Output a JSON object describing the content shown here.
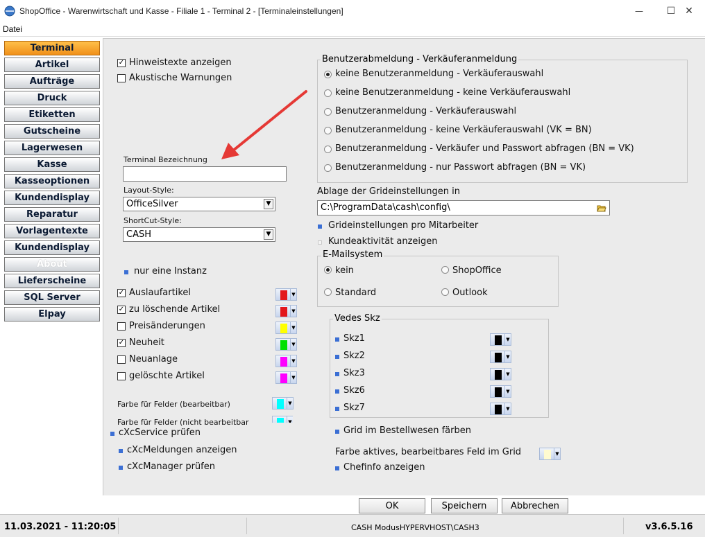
{
  "window": {
    "title": "ShopOffice - Warenwirtschaft und Kasse - Filiale 1 - Terminal 2 - [Terminaleinstellungen]",
    "minimize": "—",
    "maximize": "☐",
    "close": "✕"
  },
  "menu": {
    "datei": "Datei"
  },
  "sidebar": {
    "active": "Terminal",
    "items": [
      {
        "label": "Terminal",
        "state": "active"
      },
      {
        "label": "Artikel",
        "state": "normal"
      },
      {
        "label": "Aufträge",
        "state": "normal"
      },
      {
        "label": "Druck",
        "state": "normal"
      },
      {
        "label": "Etiketten",
        "state": "normal"
      },
      {
        "label": "Gutscheine",
        "state": "normal"
      },
      {
        "label": "Lagerwesen",
        "state": "normal"
      },
      {
        "label": "Kasse",
        "state": "normal"
      },
      {
        "label": "Kasseoptionen",
        "state": "normal"
      },
      {
        "label": "Kundendisplay",
        "state": "normal"
      },
      {
        "label": "Reparatur",
        "state": "normal"
      },
      {
        "label": "Vorlagentexte",
        "state": "normal"
      },
      {
        "label": "Kundendisplay",
        "state": "normal"
      },
      {
        "label": "About",
        "state": "disabled"
      },
      {
        "label": "Lieferscheine",
        "state": "normal"
      },
      {
        "label": "SQL Server",
        "state": "normal"
      },
      {
        "label": "Elpay",
        "state": "normal"
      }
    ]
  },
  "left": {
    "hinweistexte": {
      "label": "Hinweistexte anzeigen",
      "checked": true
    },
    "akustisch": {
      "label": "Akustische Warnungen",
      "checked": false
    },
    "terminal_bezeichnung": {
      "label": "Terminal Bezeichnung",
      "value": ""
    },
    "layout_style": {
      "label": "Layout-Style:",
      "value": "OfficeSilver"
    },
    "shortcut_style": {
      "label": "ShortCut-Style:",
      "value": "CASH"
    },
    "nur_eine_instanz": "nur eine Instanz",
    "article_flags": [
      {
        "label": "Auslaufartikel",
        "checked": true,
        "color": "#e3171b"
      },
      {
        "label": "zu löschende Artikel",
        "checked": true,
        "color": "#e3171b"
      },
      {
        "label": "Preisänderungen",
        "checked": false,
        "color": "#ffff00"
      },
      {
        "label": "Neuheit",
        "checked": true,
        "color": "#00e000"
      },
      {
        "label": "Neuanlage",
        "checked": false,
        "color": "#ff00ff"
      },
      {
        "label": "gelöschte Artikel",
        "checked": false,
        "color": "#ff00ff"
      }
    ],
    "farbe_bearbeitbar": {
      "label": "Farbe für Felder (bearbeitbar)",
      "color": "#00ffff"
    },
    "farbe_nicht_bearbeitbar": {
      "label": "Farbe für Felder (nicht bearbeitbar",
      "color": "#00ffff"
    },
    "cxc_service": "cXcService prüfen",
    "cxc_meldungen": "cXcMeldungen anzeigen",
    "cxc_manager": "cXcManager prüfen"
  },
  "right": {
    "benutzer_group": {
      "title": "Benutzerabmeldung - Verkäuferanmeldung",
      "options": [
        {
          "label": "keine Benutzeranmeldung - Verkäuferauswahl",
          "selected": true
        },
        {
          "label": "keine Benutzeranmeldung - keine Verkäuferauswahl",
          "selected": false
        },
        {
          "label": "Benutzeranmeldung - Verkäuferauswahl",
          "selected": false
        },
        {
          "label": "Benutzeranmeldung - keine Verkäuferauswahl (VK = BN)",
          "selected": false
        },
        {
          "label": "Benutzeranmeldung - Verkäufer und Passwort abfragen (BN = VK)",
          "selected": false
        },
        {
          "label": "Benutzeranmeldung - nur Passwort abfragen (BN = VK)",
          "selected": false
        }
      ]
    },
    "ablage": {
      "label": "Ablage der Grideinstellungen in",
      "value": "C:\\ProgramData\\cash\\config\\"
    },
    "grid_pro_mitarbeiter": "Grideinstellungen pro Mitarbeiter",
    "kundeaktivitaet": "Kundeaktivität anzeigen",
    "email_group": {
      "title": "E-Mailsystem",
      "options": [
        {
          "label": "kein",
          "selected": true
        },
        {
          "label": "ShopOffice",
          "selected": false
        },
        {
          "label": "Standard",
          "selected": false
        },
        {
          "label": "Outlook",
          "selected": false
        }
      ]
    },
    "vedes_group": {
      "title": "Vedes Skz",
      "items": [
        {
          "label": "Skz1",
          "color": "#000000"
        },
        {
          "label": "Skz2",
          "color": "#000000"
        },
        {
          "label": "Skz3",
          "color": "#000000"
        },
        {
          "label": "Skz6",
          "color": "#000000"
        },
        {
          "label": "Skz7",
          "color": "#000000"
        }
      ]
    },
    "grid_bestellwesen": "Grid im Bestellwesen färben",
    "farbe_aktiv": {
      "label": "Farbe aktives, bearbeitbares Feld im Grid",
      "color": "#fffbd0"
    },
    "chefinfo": "Chefinfo anzeigen"
  },
  "buttons": {
    "ok": "OK",
    "speichern": "Speichern",
    "abbrechen": "Abbrechen"
  },
  "status": {
    "datetime": "11.03.2021 - 11:20:05",
    "mode": "CASH ModusHYPERVHOST\\CASH3",
    "version": "v3.6.5.16"
  },
  "colors": {
    "accent_active": "#f5a024",
    "checkbox_blue": "#3b6fd4",
    "annotation_arrow": "#e53935"
  }
}
